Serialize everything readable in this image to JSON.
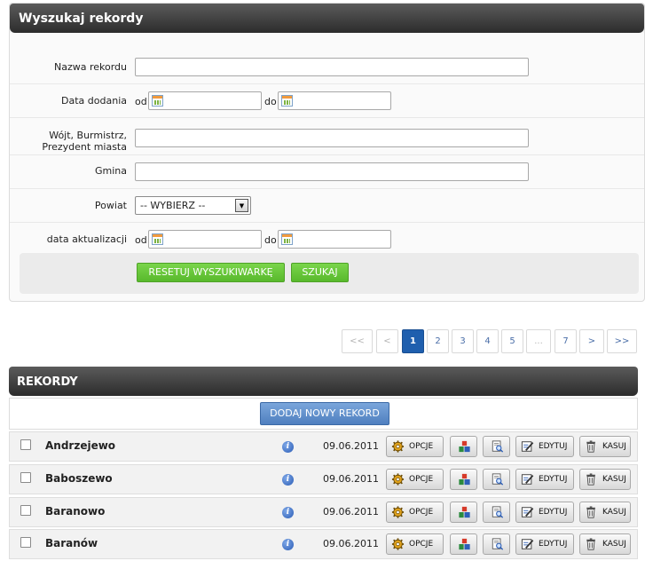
{
  "search": {
    "title": "Wyszukaj rekordy",
    "labels": {
      "name": "Nazwa rekordu",
      "date_added": "Data dodania",
      "mayor_line1": "Wójt, Burmistrz,",
      "mayor_line2": "Prezydent miasta",
      "gmina": "Gmina",
      "powiat": "Powiat",
      "updated": "data aktualizacji"
    },
    "from_label": "od",
    "to_label": "do",
    "powiat_selected": "-- WYBIERZ --",
    "reset_label": "RESETUJ WYSZUKIWARKĘ",
    "search_label": "SZUKAJ"
  },
  "pagination": {
    "first": "<<",
    "prev": "<",
    "pages": [
      "1",
      "2",
      "3",
      "4",
      "5",
      "...",
      "7"
    ],
    "next": ">",
    "last": ">>",
    "current": "1"
  },
  "records": {
    "title": "REKORDY",
    "add_label": "DODAJ NOWY REKORD",
    "options_label": "OPCJE",
    "edit_label": "EDYTUJ",
    "delete_label": "KASUJ",
    "items": [
      {
        "name": "Andrzejewo",
        "date": "09.06.2011"
      },
      {
        "name": "Baboszewo",
        "date": "09.06.2011"
      },
      {
        "name": "Baranowo",
        "date": "09.06.2011"
      },
      {
        "name": "Baranów",
        "date": "09.06.2011"
      }
    ]
  },
  "icons": {
    "calendar": "calendar-icon",
    "info": "info-icon",
    "options": "gear-icon",
    "stats": "blocks-icon",
    "preview": "document-search-icon",
    "edit": "edit-icon",
    "delete": "trash-icon"
  },
  "colors": {
    "header_dark": "#2c2c2c",
    "green_button": "#58b92c",
    "blue_button": "#4f7fbf",
    "active_page": "#1f5fae"
  }
}
